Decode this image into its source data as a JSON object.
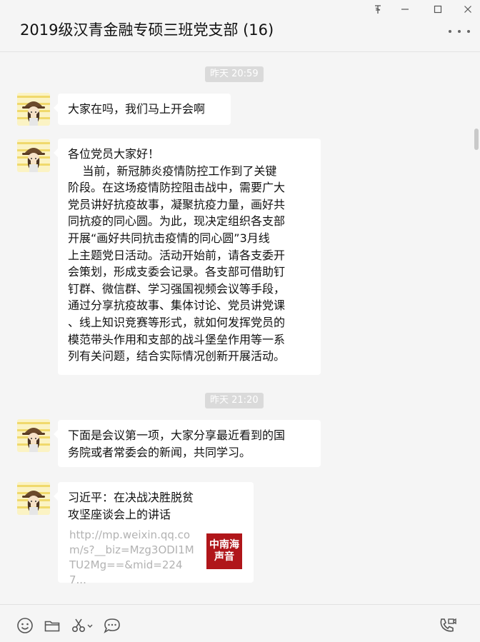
{
  "window": {
    "title": "2019级汉青金融专硕三班党支部 (16)",
    "controls": [
      "pin",
      "minimize",
      "maximize",
      "close"
    ]
  },
  "messages": [
    {
      "type": "time",
      "text": "昨天 20:59"
    },
    {
      "type": "text",
      "sender_avatar": "avatar-cartoon-girl",
      "text": "大家在吗，我们马上开会啊"
    },
    {
      "type": "text",
      "sender_avatar": "avatar-cartoon-girl",
      "lines": [
        "各位党员大家好！",
        "    当前，新冠肺炎疫情防控工作到了关键",
        "阶段。在这场疫情防控阻击战中，需要广大",
        "党员讲好抗疫故事，凝聚抗疫力量，画好共",
        "同抗疫的同心圆。为此，现决定组织各支部",
        "开展“画好共同抗击疫情的同心圆”3月线",
        "上主题党日活动。活动开始前，请各支委开",
        "会策划，形成支委会记录。各支部可借助钉",
        "钉群、微信群、学习强国视频会议等手段，",
        "通过分享抗疫故事、集体讨论、党员讲党课",
        "、线上知识竞赛等形式，就如何发挥党员的",
        "模范带头作用和支部的战斗堡垒作用等一系",
        "列有关问题，结合实际情况创新开展活动。"
      ]
    },
    {
      "type": "time",
      "text": "昨天 21:20"
    },
    {
      "type": "text",
      "sender_avatar": "avatar-cartoon-girl",
      "lines": [
        "下面是会议第一项，大家分享最近看到的国",
        "务院或者常委会的新闻，共同学习。"
      ]
    },
    {
      "type": "link",
      "sender_avatar": "avatar-cartoon-girl",
      "title_lines": [
        "习近平：在决战决胜脱贫",
        "攻坚座谈会上的讲话"
      ],
      "url_lines": [
        "http://mp.weixin.qq.co",
        "m/s?__biz=Mzg3ODI1M",
        "TU2Mg==&mid=2247..."
      ],
      "thumb_lines": [
        "中南海",
        "声音"
      ]
    }
  ],
  "toolbar": {
    "tools": [
      "emoji-icon",
      "folder-icon",
      "scissors-icon",
      "chat-bubble-icon",
      "video-call-icon"
    ]
  },
  "colors": {
    "background": "#f5f5f5",
    "bubble": "#ffffff",
    "time_pill": "#dadada",
    "thumb": "#b0161a"
  }
}
